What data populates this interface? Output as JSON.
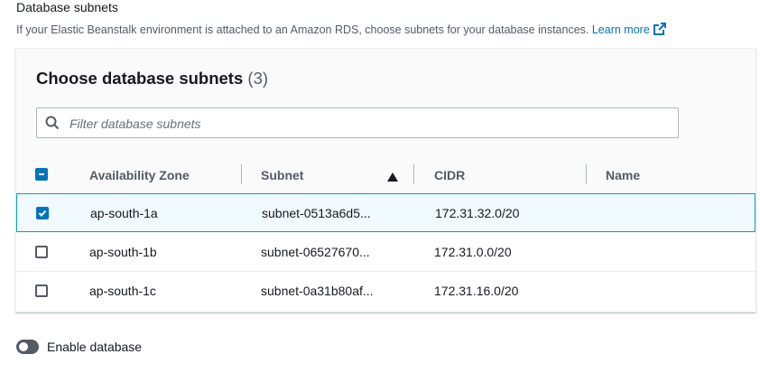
{
  "section": {
    "title": "Database subnets",
    "description": "If your Elastic Beanstalk environment is attached to an Amazon RDS, choose subnets for your database instances.",
    "learn_more": "Learn more"
  },
  "panel": {
    "title": "Choose database subnets",
    "count": "(3)"
  },
  "filter": {
    "placeholder": "Filter database subnets"
  },
  "table": {
    "columns": [
      "Availability Zone",
      "Subnet",
      "CIDR",
      "Name"
    ],
    "sorted_column": "Subnet",
    "sort_direction": "ascending",
    "select_all_state": "indeterminate",
    "rows": [
      {
        "zone": "ap-south-1a",
        "subnet": "subnet-0513a6d5...",
        "cidr": "172.31.32.0/20",
        "name": "",
        "selected": true
      },
      {
        "zone": "ap-south-1b",
        "subnet": "subnet-06527670...",
        "cidr": "172.31.0.0/20",
        "name": "",
        "selected": false
      },
      {
        "zone": "ap-south-1c",
        "subnet": "subnet-0a31b80af...",
        "cidr": "172.31.16.0/20",
        "name": "",
        "selected": false
      }
    ]
  },
  "toggle": {
    "label": "Enable database",
    "on": false
  },
  "colors": {
    "accent": "#0073bb",
    "selected_border": "#00a1c9",
    "selected_bg": "#f1faff"
  }
}
